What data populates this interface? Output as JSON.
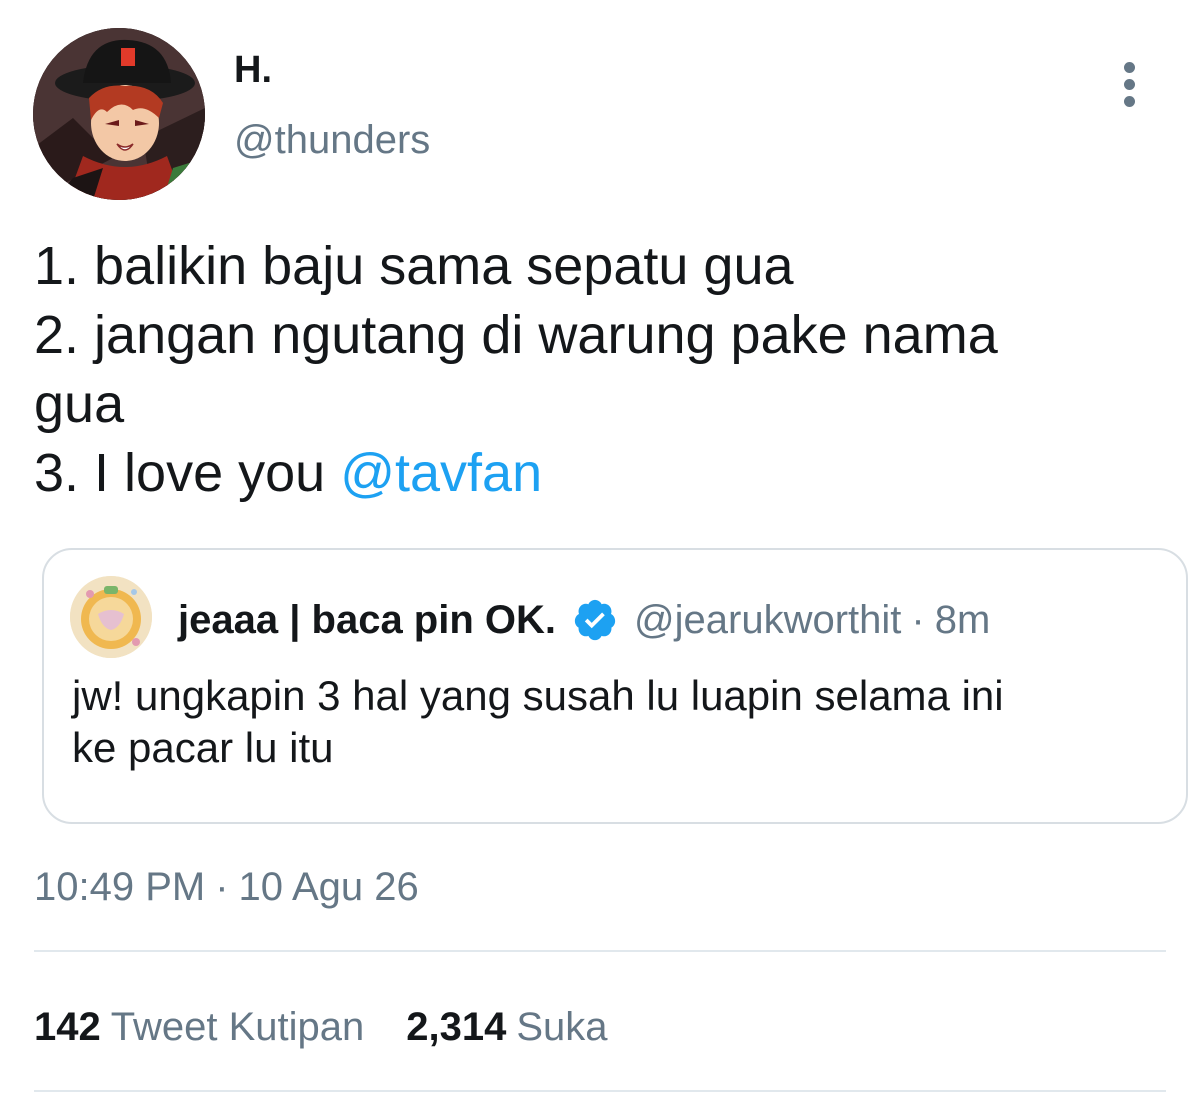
{
  "author": {
    "display_name": "H.",
    "handle": "@thunders",
    "avatar_icon": "anime-avatar"
  },
  "tweet": {
    "lines": [
      "1. balikin baju sama sepatu gua",
      "2. jangan ngutang di warung pake nama",
      "gua",
      "3. I love you "
    ],
    "mention": "@tavfan"
  },
  "quote": {
    "display_name": "jeaaa | baca pin OK.",
    "handle": "@jearukworthit",
    "separator": "·",
    "time": "8m",
    "verified_icon": "verified-badge-icon",
    "lines": [
      "jw! ungkapin 3 hal yang susah lu luapin selama ini",
      "ke pacar lu itu"
    ]
  },
  "timestamp": {
    "time": "10:49 PM",
    "separator": "·",
    "date": "10 Agu 26"
  },
  "stats": {
    "quotes_count": "142",
    "quotes_label": "Tweet Kutipan",
    "likes_count": "2,314",
    "likes_label": "Suka"
  },
  "colors": {
    "link": "#1da1f2",
    "secondary_text": "#657786",
    "border": "#d8dee3"
  }
}
